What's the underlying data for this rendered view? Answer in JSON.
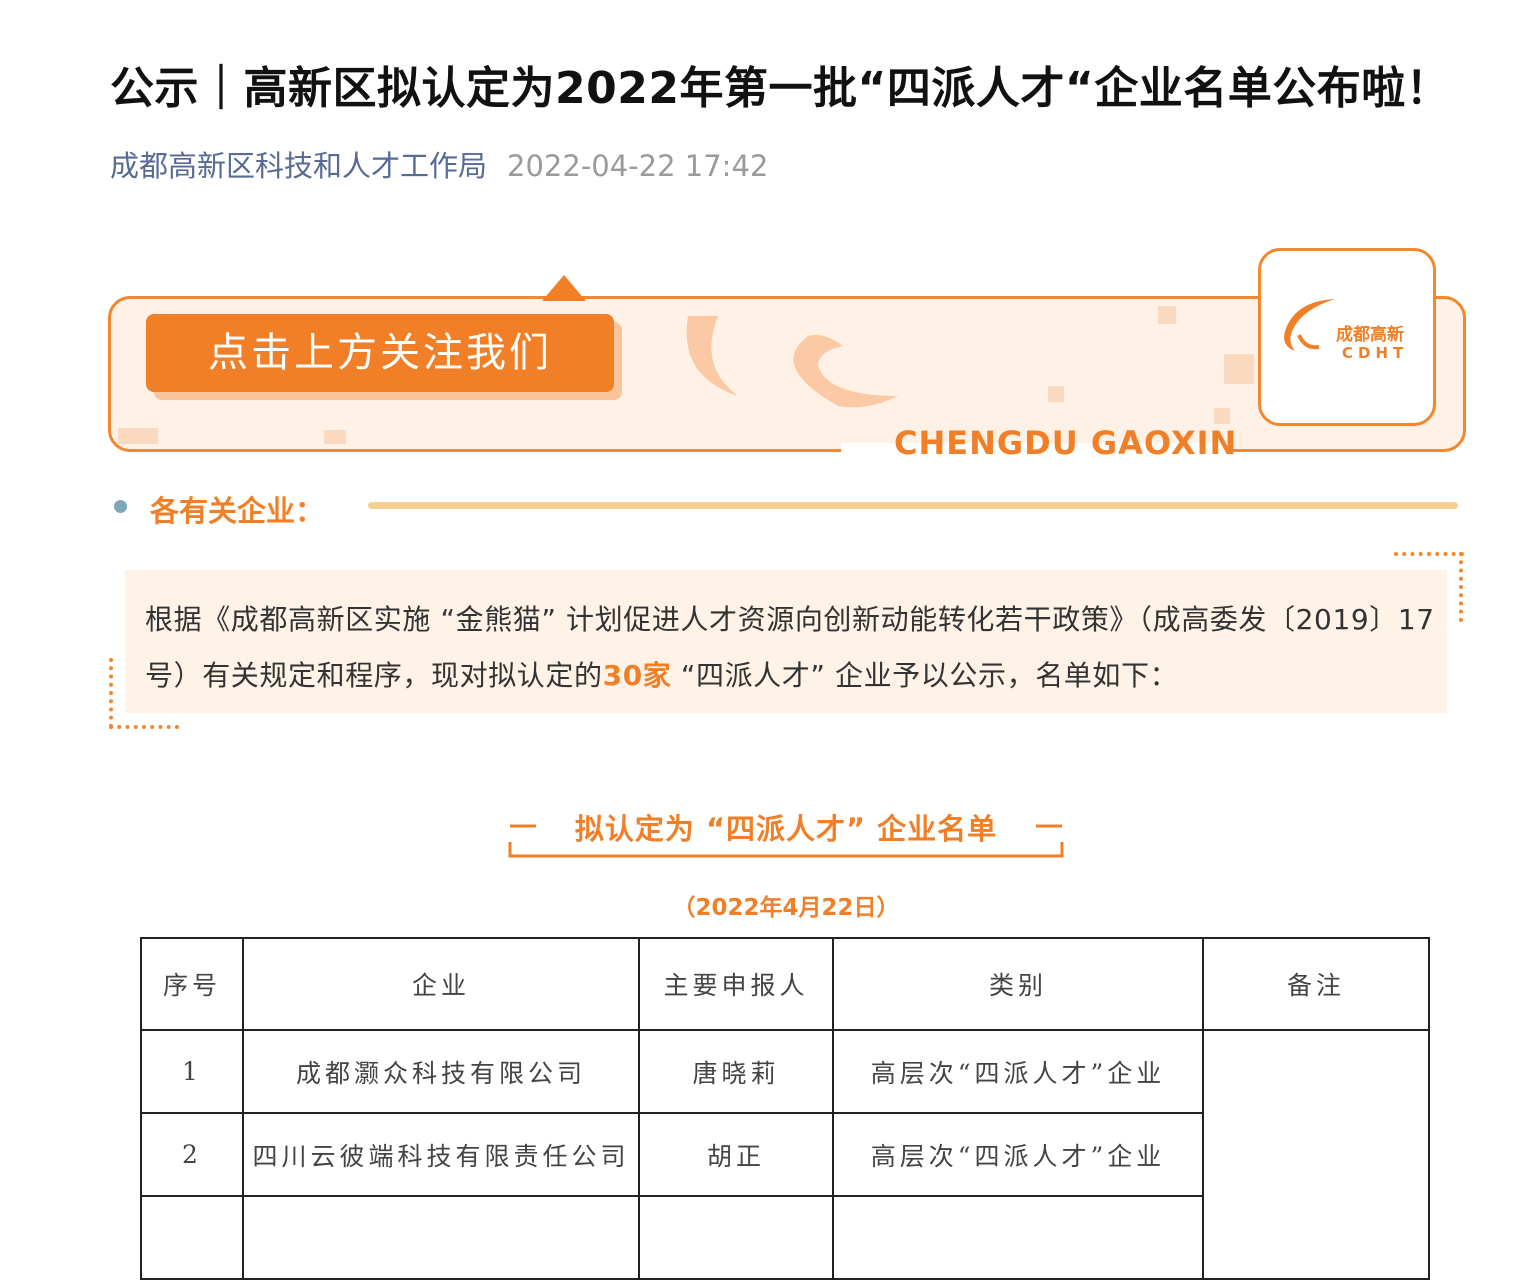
{
  "article": {
    "title": "公示｜高新区拟认定为2022年第一批“四派人才“企业名单公布啦！",
    "author": "成都高新区科技和人才工作局",
    "date": "2022-04-22 17:42"
  },
  "banner": {
    "follow_text": "点击上方关注我们",
    "logo_cn": "成都高新",
    "logo_en": "CDHT",
    "english_title": "CHENGDU GAOXIN",
    "accent_color": "#f07f27"
  },
  "section": {
    "heading": "各有关企业："
  },
  "intro": {
    "text_before": "根据《成都高新区实施 “金熊猫” 计划促进人才资源向创新动能转化若干政策》（成高委发〔2019〕17号）有关规定和程序，现对拟认定的",
    "highlight": "30家",
    "text_after": " “四派人才” 企业予以公示，名单如下："
  },
  "list": {
    "title": "拟认定为 “四派人才” 企业名单",
    "date": "（2022年4月22日）",
    "headers": [
      "序号",
      "企业",
      "主要申报人",
      "类别",
      "备注"
    ],
    "rows": [
      {
        "no": "1",
        "company": "成都灏众科技有限公司",
        "applicant": "唐晓莉",
        "category": "高层次“四派人才”企业"
      },
      {
        "no": "2",
        "company": "四川云彼端科技有限责任公司",
        "applicant": "胡正",
        "category": "高层次“四派人才”企业"
      }
    ]
  }
}
